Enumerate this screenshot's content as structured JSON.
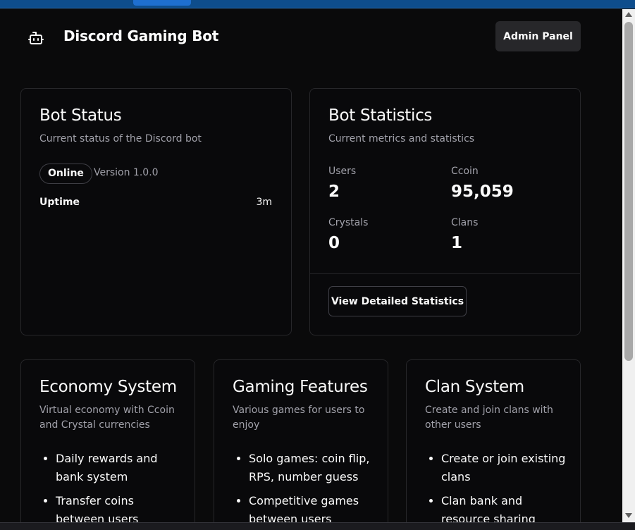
{
  "header": {
    "icon": "bot-icon",
    "title": "Discord Gaming Bot",
    "admin_button": "Admin Panel"
  },
  "status_card": {
    "title": "Bot Status",
    "description": "Current status of the Discord bot",
    "status": "Online",
    "version": "Version 1.0.0",
    "uptime_label": "Uptime",
    "uptime_value": "3m"
  },
  "stats_card": {
    "title": "Bot Statistics",
    "description": "Current metrics and statistics",
    "stats": [
      {
        "label": "Users",
        "value": "2"
      },
      {
        "label": "Ccoin",
        "value": "95,059"
      },
      {
        "label": "Crystals",
        "value": "0"
      },
      {
        "label": "Clans",
        "value": "1"
      }
    ],
    "detail_button": "View Detailed Statistics"
  },
  "features": [
    {
      "title": "Economy System",
      "description": "Virtual economy with Ccoin and Crystal currencies",
      "items": [
        "Daily rewards and bank system",
        "Transfer coins between users"
      ]
    },
    {
      "title": "Gaming Features",
      "description": "Various games for users to enjoy",
      "items": [
        "Solo games: coin flip, RPS, number guess",
        "Competitive games between users"
      ]
    },
    {
      "title": "Clan System",
      "description": "Create and join clans with other users",
      "items": [
        "Create or join existing clans",
        "Clan bank and resource sharing"
      ]
    }
  ],
  "colors": {
    "background": "#0a0a0b",
    "card_border": "#27272a",
    "muted_text": "#a1a1aa",
    "button_bg": "#27272a"
  }
}
